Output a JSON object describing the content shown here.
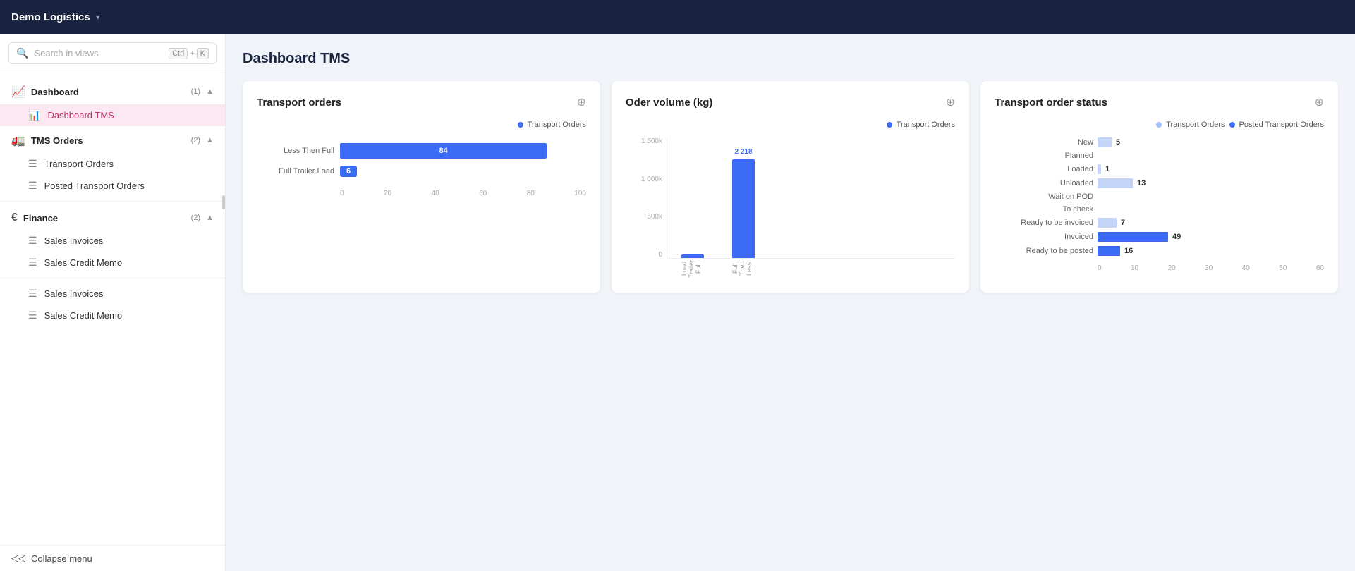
{
  "topbar": {
    "title": "Demo Logistics",
    "chevron": "▾"
  },
  "search": {
    "placeholder": "Search in views",
    "ctrl_label": "Ctrl",
    "plus": "+",
    "k_label": "K"
  },
  "sidebar": {
    "sections": [
      {
        "id": "dashboard",
        "icon": "📈",
        "label": "Dashboard",
        "badge": "(1)",
        "expanded": true,
        "items": [
          {
            "id": "dashboard-tms",
            "label": "Dashboard TMS",
            "active": true,
            "icon": "📊"
          }
        ]
      },
      {
        "id": "tms-orders",
        "icon": "🚛",
        "label": "TMS Orders",
        "badge": "(2)",
        "expanded": true,
        "items": [
          {
            "id": "transport-orders",
            "label": "Transport Orders",
            "active": false,
            "icon": "☰"
          },
          {
            "id": "posted-transport-orders",
            "label": "Posted Transport Orders",
            "active": false,
            "icon": "☰"
          }
        ]
      },
      {
        "id": "finance",
        "icon": "€",
        "label": "Finance",
        "badge": "(2)",
        "expanded": true,
        "items": [
          {
            "id": "sales-invoices-1",
            "label": "Sales Invoices",
            "active": false,
            "icon": "☰"
          },
          {
            "id": "sales-credit-memo-1",
            "label": "Sales Credit Memo",
            "active": false,
            "icon": "☰"
          },
          {
            "id": "sales-invoices-2",
            "label": "Sales Invoices",
            "active": false,
            "icon": "☰"
          },
          {
            "id": "sales-credit-memo-2",
            "label": "Sales Credit Memo",
            "active": false,
            "icon": "☰"
          }
        ]
      }
    ],
    "collapse_label": "Collapse menu"
  },
  "content": {
    "page_title": "Dashboard TMS",
    "cards": [
      {
        "id": "transport-orders",
        "title": "Transport orders",
        "legend": [
          "Transport Orders"
        ],
        "type": "hbar",
        "bars": [
          {
            "label": "Less Then Full",
            "value": 84,
            "max": 100,
            "pct": 84
          },
          {
            "label": "Full Trailer Load",
            "value": 6,
            "max": 100,
            "pct": 6,
            "badge": true
          }
        ],
        "axis": [
          0,
          20,
          40,
          60,
          80,
          100
        ]
      },
      {
        "id": "order-volume",
        "title": "Oder volume (kg)",
        "legend": [
          "Transport Orders"
        ],
        "type": "vbar",
        "y_labels": [
          "1 500k",
          "1 000k",
          "500k",
          "0"
        ],
        "bars": [
          {
            "label": "Full Trailer Load",
            "value": null,
            "height_pct": 3
          },
          {
            "label": "Less Then Full",
            "value": "2 218",
            "height_pct": 85
          }
        ]
      },
      {
        "id": "transport-order-status",
        "title": "Transport order status",
        "legend": [
          "Transport Orders",
          "Posted Transport Orders"
        ],
        "type": "status",
        "rows": [
          {
            "label": "New",
            "val1": 5,
            "val2": null,
            "bar1_w": 20,
            "bar2_w": 0
          },
          {
            "label": "Planned",
            "val1": null,
            "val2": null,
            "bar1_w": 0,
            "bar2_w": 0
          },
          {
            "label": "Loaded",
            "val1": 1,
            "val2": null,
            "bar1_w": 4,
            "bar2_w": 0
          },
          {
            "label": "Unloaded",
            "val1": 13,
            "val2": null,
            "bar1_w": 52,
            "bar2_w": 0
          },
          {
            "label": "Wait on POD",
            "val1": null,
            "val2": null,
            "bar1_w": 0,
            "bar2_w": 0
          },
          {
            "label": "To check",
            "val1": null,
            "val2": null,
            "bar1_w": 0,
            "bar2_w": 0
          },
          {
            "label": "Ready to be invoiced",
            "val1": 7,
            "val2": null,
            "bar1_w": 28,
            "bar2_w": 0
          },
          {
            "label": "Invoiced",
            "val1": null,
            "val2": 49,
            "bar1_w": 0,
            "bar2_w": 100
          },
          {
            "label": "Ready to be posted",
            "val1": null,
            "val2": 16,
            "bar1_w": 0,
            "bar2_w": 32
          }
        ],
        "axis": [
          0,
          10,
          20,
          30,
          40,
          50,
          60
        ]
      }
    ]
  }
}
